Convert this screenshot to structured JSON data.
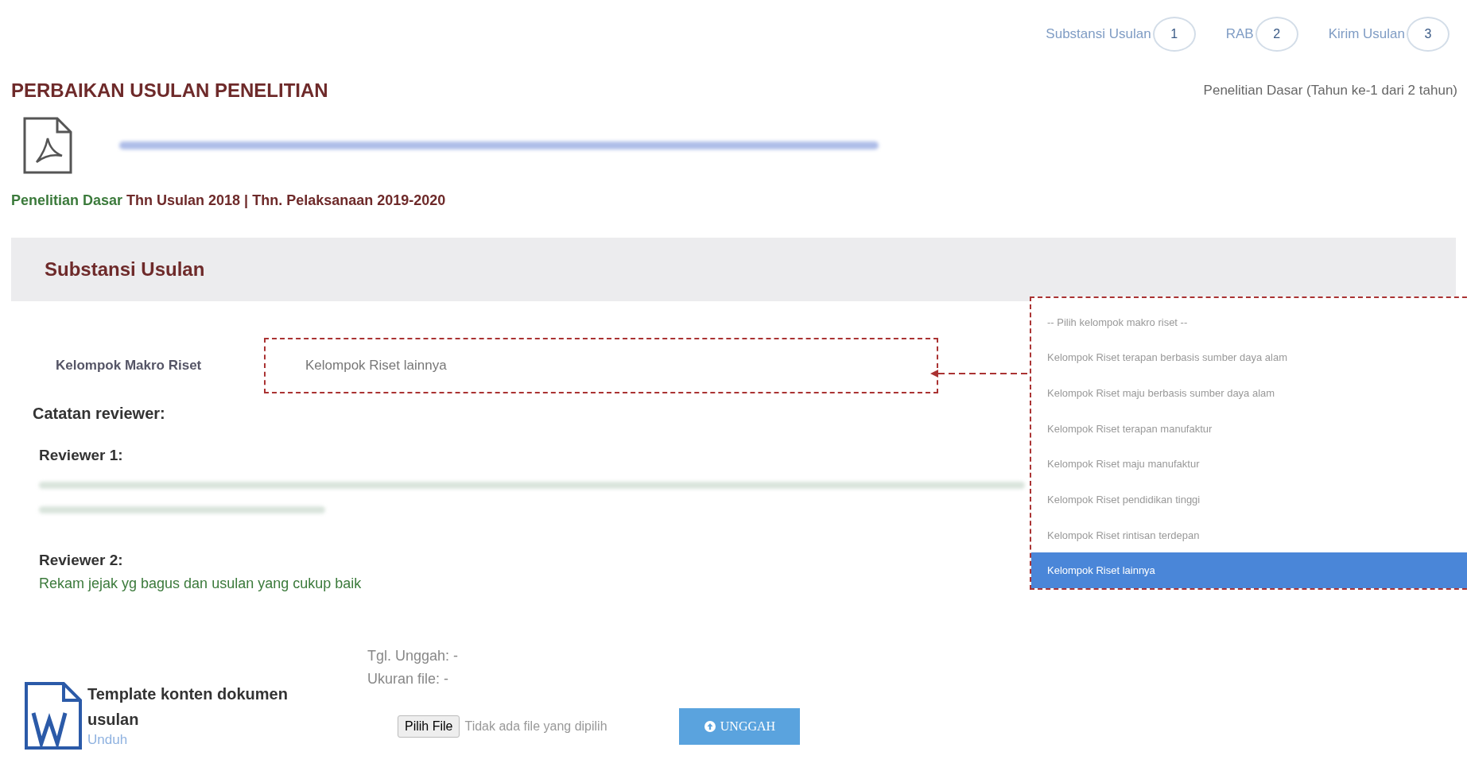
{
  "steps": [
    {
      "label": "Substansi Usulan",
      "number": "1"
    },
    {
      "label": "RAB",
      "number": "2"
    },
    {
      "label": "Kirim Usulan",
      "number": "3"
    }
  ],
  "page_title": "PERBAIKAN USULAN PENELITIAN",
  "scheme_info": "Penelitian Dasar (Tahun ke-1 dari 2 tahun)",
  "meta": {
    "scheme": "Penelitian Dasar",
    "details": "Thn Usulan 2018 | Thn. Pelaksanaan 2019-2020"
  },
  "section_title": "Substansi Usulan",
  "macro_field": {
    "label": "Kelompok Makro Riset",
    "value": "Kelompok Riset lainnya"
  },
  "dropdown_options": [
    {
      "label": "-- Pilih kelompok makro riset --",
      "selected": false
    },
    {
      "label": "Kelompok Riset terapan berbasis sumber daya alam",
      "selected": false
    },
    {
      "label": "Kelompok Riset maju berbasis sumber daya alam",
      "selected": false
    },
    {
      "label": "Kelompok Riset terapan manufaktur",
      "selected": false
    },
    {
      "label": "Kelompok Riset maju manufaktur",
      "selected": false
    },
    {
      "label": "Kelompok Riset pendidikan tinggi",
      "selected": false
    },
    {
      "label": "Kelompok Riset rintisan terdepan",
      "selected": false
    },
    {
      "label": "Kelompok Riset lainnya",
      "selected": true
    }
  ],
  "reviewer_notes": {
    "title": "Catatan reviewer:",
    "reviewers": [
      {
        "name": "Reviewer 1:",
        "blurred": true
      },
      {
        "name": "Reviewer 2:",
        "comment": "Rekam jejak yg bagus dan usulan yang cukup baik"
      }
    ]
  },
  "template": {
    "title": "Template konten dokumen usulan",
    "link": "Unduh"
  },
  "upload": {
    "date": "Tgl. Unggah: -",
    "size": "Ukuran file: -",
    "choose_button": "Pilih File",
    "no_file": "Tidak ada file yang dipilih",
    "upload_button": "UNGGAH"
  }
}
